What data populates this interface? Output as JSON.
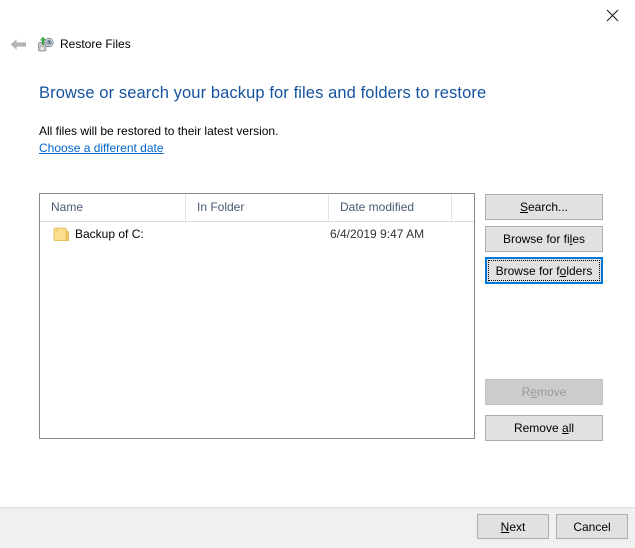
{
  "window": {
    "title": "Restore Files",
    "app_icon": "restore-files-icon",
    "close_icon": "close-icon",
    "back_icon": "back-arrow-icon"
  },
  "heading": "Browse or search your backup for files and folders to restore",
  "subtext": "All files will be restored to their latest version.",
  "date_link": "Choose a different date",
  "listview": {
    "columns": [
      {
        "label": "Name"
      },
      {
        "label": "In Folder"
      },
      {
        "label": "Date modified"
      },
      {
        "label": ""
      }
    ],
    "rows": [
      {
        "icon": "folder-icon",
        "name": "Backup of C:",
        "in_folder": "",
        "date_modified": "6/4/2019 9:47 AM"
      }
    ]
  },
  "side_buttons": {
    "search": {
      "label": "Search...",
      "mnemonic": "S",
      "state": "enabled"
    },
    "browse_files": {
      "label": "Browse for files",
      "mnemonic": "l",
      "state": "enabled"
    },
    "browse_folders": {
      "label": "Browse for folders",
      "mnemonic": "o",
      "state": "focused"
    },
    "remove": {
      "label": "Remove",
      "mnemonic": "e",
      "state": "disabled"
    },
    "remove_all": {
      "label": "Remove all",
      "mnemonic": "a",
      "state": "enabled"
    }
  },
  "footer_buttons": {
    "next": {
      "label": "Next",
      "mnemonic": "N",
      "state": "enabled"
    },
    "cancel": {
      "label": "Cancel",
      "state": "enabled"
    }
  },
  "colors": {
    "heading_blue": "#15539e",
    "link_blue": "#0066cc",
    "focus_blue": "#0078d7",
    "button_face": "#e1e1e1",
    "button_border": "#adadad",
    "footer_bg": "#f0f0f0",
    "listview_border": "#828790",
    "column_header_text": "#4a5a74",
    "folder_yellow": "#fcdf8e"
  }
}
